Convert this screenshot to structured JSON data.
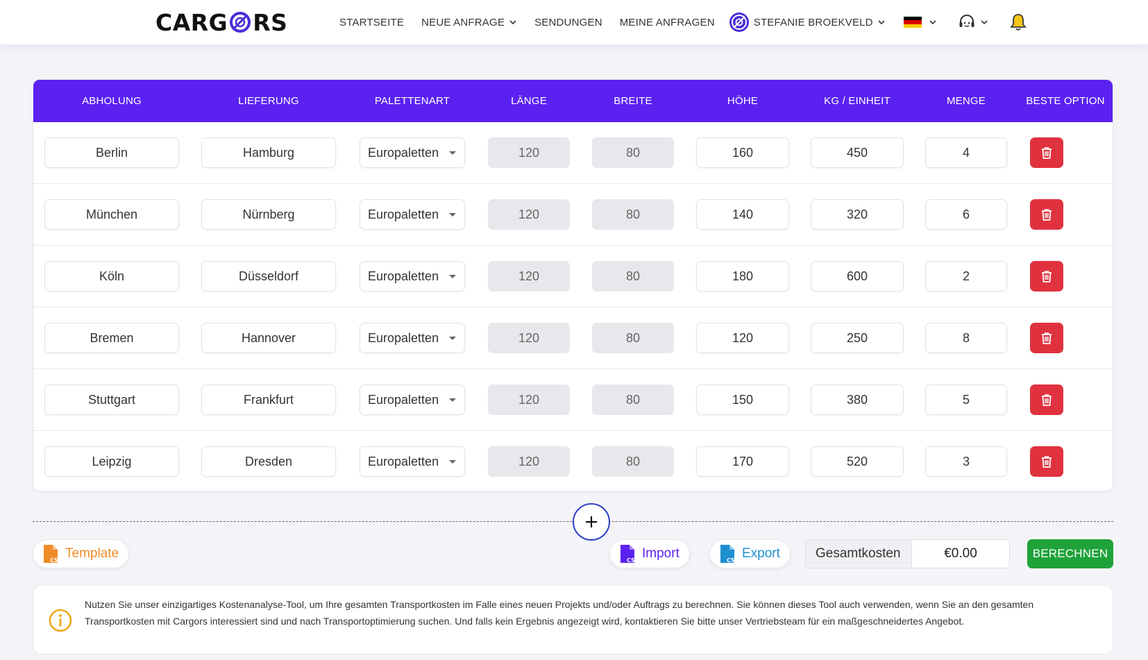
{
  "brand": {
    "logo_left": "CARG",
    "logo_right": "RS"
  },
  "nav": {
    "home": "STARTSEITE",
    "new_request": "NEUE ANFRAGE",
    "shipments": "SENDUNGEN",
    "my_requests": "MEINE ANFRAGEN",
    "user": "STEFANIE BROEKVELD"
  },
  "table": {
    "headers": [
      "ABHOLUNG",
      "LIEFERUNG",
      "PALETTENART",
      "LÄNGE",
      "BREITE",
      "HÖHE",
      "KG / EINHEIT",
      "MENGE",
      "BESTE OPTION"
    ],
    "rows": [
      {
        "pickup": "Berlin",
        "delivery": "Hamburg",
        "pallet": "Europaletten",
        "length": "120",
        "width": "80",
        "height": "160",
        "kg": "450",
        "qty": "4"
      },
      {
        "pickup": "München",
        "delivery": "Nürnberg",
        "pallet": "Europaletten",
        "length": "120",
        "width": "80",
        "height": "140",
        "kg": "320",
        "qty": "6"
      },
      {
        "pickup": "Köln",
        "delivery": "Düsseldorf",
        "pallet": "Europaletten",
        "length": "120",
        "width": "80",
        "height": "180",
        "kg": "600",
        "qty": "2"
      },
      {
        "pickup": "Bremen",
        "delivery": "Hannover",
        "pallet": "Europaletten",
        "length": "120",
        "width": "80",
        "height": "120",
        "kg": "250",
        "qty": "8"
      },
      {
        "pickup": "Stuttgart",
        "delivery": "Frankfurt",
        "pallet": "Europaletten",
        "length": "120",
        "width": "80",
        "height": "150",
        "kg": "380",
        "qty": "5"
      },
      {
        "pickup": "Leipzig",
        "delivery": "Dresden",
        "pallet": "Europaletten",
        "length": "120",
        "width": "80",
        "height": "170",
        "kg": "520",
        "qty": "3"
      }
    ]
  },
  "actions": {
    "template": "Template",
    "import": "Import",
    "export": "Export",
    "total_label": "Gesamtkosten",
    "total_value": "€0.00",
    "calculate": "BERECHNEN",
    "csv_badge": "CSV"
  },
  "info": {
    "text": "Nutzen Sie unser einzigartiges Kostenanalyse-Tool, um Ihre gesamten Transportkosten im Falle eines neuen Projekts und/oder Auftrags zu berechnen. Sie können dieses Tool auch verwenden, wenn Sie an den gesamten Transportkosten mit Cargors interessiert sind und nach Transportoptimierung suchen. Und falls kein Ergebnis angezeigt wird, kontaktieren Sie bitte unser Vertriebsteam für ein maßgeschneidertes Angebot."
  },
  "colors": {
    "accent": "#5b21f0",
    "delete": "#e0323e",
    "calculate": "#1fa23a",
    "template": "#f08c28",
    "import": "#5b21f0",
    "export": "#1e8fd0"
  },
  "icons": [
    "logo-o-icon",
    "chevron-down-icon",
    "avatar-icon",
    "flag-de-icon",
    "support-headset-icon",
    "bell-icon",
    "trash-icon",
    "plus-icon",
    "csv-file-icon",
    "info-icon"
  ]
}
